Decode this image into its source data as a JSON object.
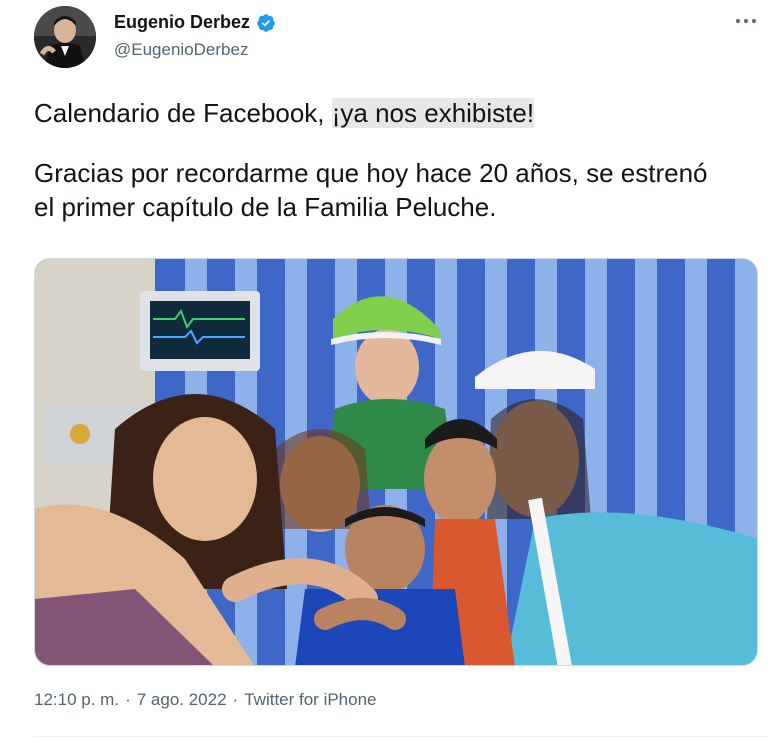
{
  "author": {
    "display_name": "Eugenio Derbez",
    "handle": "@EugenioDerbez",
    "verified": true
  },
  "tweet": {
    "line1_before": "Calendario de Facebook, ",
    "line1_highlight": "¡ya nos exhibiste!",
    "line2": "Gracias por recordarme que hoy hace 20 años, se estrenó el primer capítulo de la Familia Peluche."
  },
  "meta": {
    "time": "12:10 p. m.",
    "separator": "·",
    "date": "7 ago. 2022",
    "source": "Twitter for iPhone"
  },
  "icons": {
    "verified": "verified-badge-icon",
    "more": "more-options-icon"
  },
  "colors": {
    "verified_blue": "#1d9bf0",
    "secondary_text": "#536471",
    "highlight": "#e7e7e7"
  }
}
